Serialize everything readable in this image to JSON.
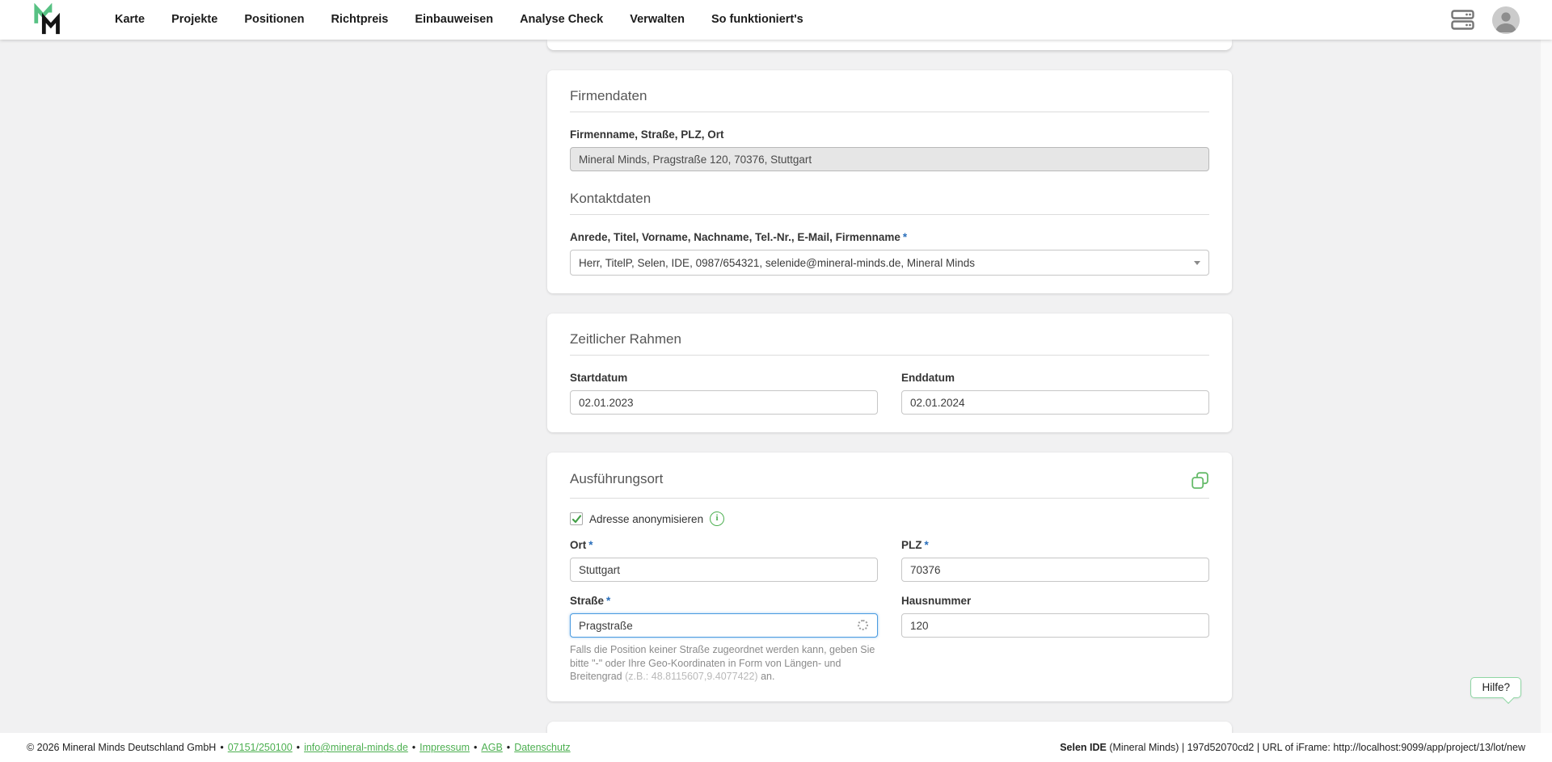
{
  "misc": {
    "required_marker": "*"
  },
  "colors": {
    "accent_green": "#4caf50",
    "logo_green": "#57c183",
    "focus_blue": "#4a9be0",
    "asterisk_blue": "#2a6fbb"
  },
  "navbar": {
    "items": [
      "Karte",
      "Projekte",
      "Positionen",
      "Richtpreis",
      "Einbauweisen",
      "Analyse Check",
      "Verwalten",
      "So funktioniert's"
    ]
  },
  "cards": {
    "firmendaten": {
      "title": "Firmendaten",
      "company_label": "Firmenname, Straße, PLZ, Ort",
      "company_value": "Mineral Minds, Pragstraße 120, 70376, Stuttgart",
      "kontakt_title": "Kontaktdaten",
      "contact_label": "Anrede, Titel, Vorname, Nachname, Tel.-Nr., E-Mail, Firmenname",
      "contact_value": "Herr, TitelP, Selen, IDE, 0987/654321, selenide@mineral-minds.de, Mineral Minds"
    },
    "zeitraum": {
      "title": "Zeitlicher Rahmen",
      "start_label": "Startdatum",
      "start_value": "02.01.2023",
      "end_label": "Enddatum",
      "end_value": "02.01.2024"
    },
    "ort": {
      "title": "Ausführungsort",
      "anonymize_label": "Adresse anonymisieren",
      "info_glyph": "i",
      "ort_label": "Ort",
      "ort_value": "Stuttgart",
      "plz_label": "PLZ",
      "plz_value": "70376",
      "strasse_label": "Straße",
      "strasse_value": "Pragstraße",
      "hausnummer_label": "Hausnummer",
      "hausnummer_value": "120",
      "helper_text_1": "Falls die Position keiner Straße zugeordnet werden kann, geben Sie bitte \"-\" oder Ihre Geo-Koordinaten in Form von Längen- und Breitengrad ",
      "helper_text_muted": "(z.B.: 48.8115607,9.4077422)",
      "helper_text_2": " an."
    }
  },
  "help_button_label": "Hilfe?",
  "footer": {
    "separator": "•",
    "copyright": "© 2026 Mineral Minds Deutschland GmbH",
    "phone": "07151/250100",
    "email": "info@mineral-minds.de",
    "link_impressum": "Impressum",
    "link_agb": "AGB",
    "link_datenschutz": "Datenschutz",
    "right_bold": "Selen IDE",
    "right_rest": " (Mineral Minds) | 197d52070cd2 | URL of iFrame: http://localhost:9099/app/project/13/lot/new"
  }
}
